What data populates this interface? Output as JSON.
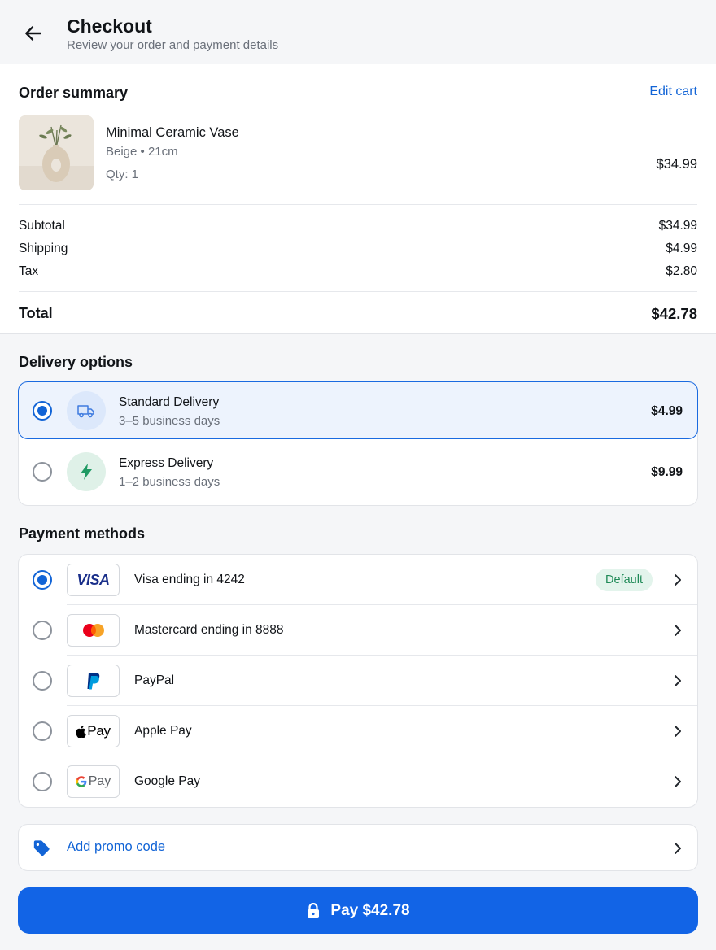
{
  "header": {
    "title": "Checkout",
    "subtitle": "Review your order and payment details"
  },
  "summary": {
    "title": "Order summary",
    "edit_label": "Edit cart",
    "product": {
      "name": "Minimal Ceramic Vase",
      "variant": "Beige • 21cm",
      "qty": "Qty: 1",
      "price": "$34.99"
    },
    "rows": [
      {
        "label": "Subtotal",
        "value": "$34.99"
      },
      {
        "label": "Shipping",
        "value": "$4.99"
      },
      {
        "label": "Tax",
        "value": "$2.80"
      }
    ],
    "total_label": "Total",
    "total_value": "$42.78"
  },
  "delivery": {
    "title": "Delivery options",
    "options": [
      {
        "name": "Standard Delivery",
        "time": "3–5 business days",
        "price": "$4.99",
        "selected": true,
        "icon": "truck-icon"
      },
      {
        "name": "Express Delivery",
        "time": "1–2 business days",
        "price": "$9.99",
        "selected": false,
        "icon": "lightning-icon"
      }
    ]
  },
  "payment": {
    "title": "Payment methods",
    "methods": [
      {
        "name": "Visa ending in 4242",
        "logo_text": "VISA",
        "badge": "Default",
        "selected": true
      },
      {
        "name": "Mastercard ending in 8888",
        "selected": false
      },
      {
        "name": "PayPal",
        "selected": false
      },
      {
        "name": "Apple Pay",
        "logo_text": "Pay",
        "selected": false
      },
      {
        "name": "Google Pay",
        "logo_text": "Pay",
        "selected": false
      }
    ]
  },
  "promo": {
    "label": "Add promo code"
  },
  "pay_button": {
    "label": "Pay $42.78"
  },
  "colors": {
    "accent": "#1264e6",
    "link": "#1264d6",
    "badge_bg": "#e3f4ec",
    "badge_text": "#1f8a57"
  }
}
